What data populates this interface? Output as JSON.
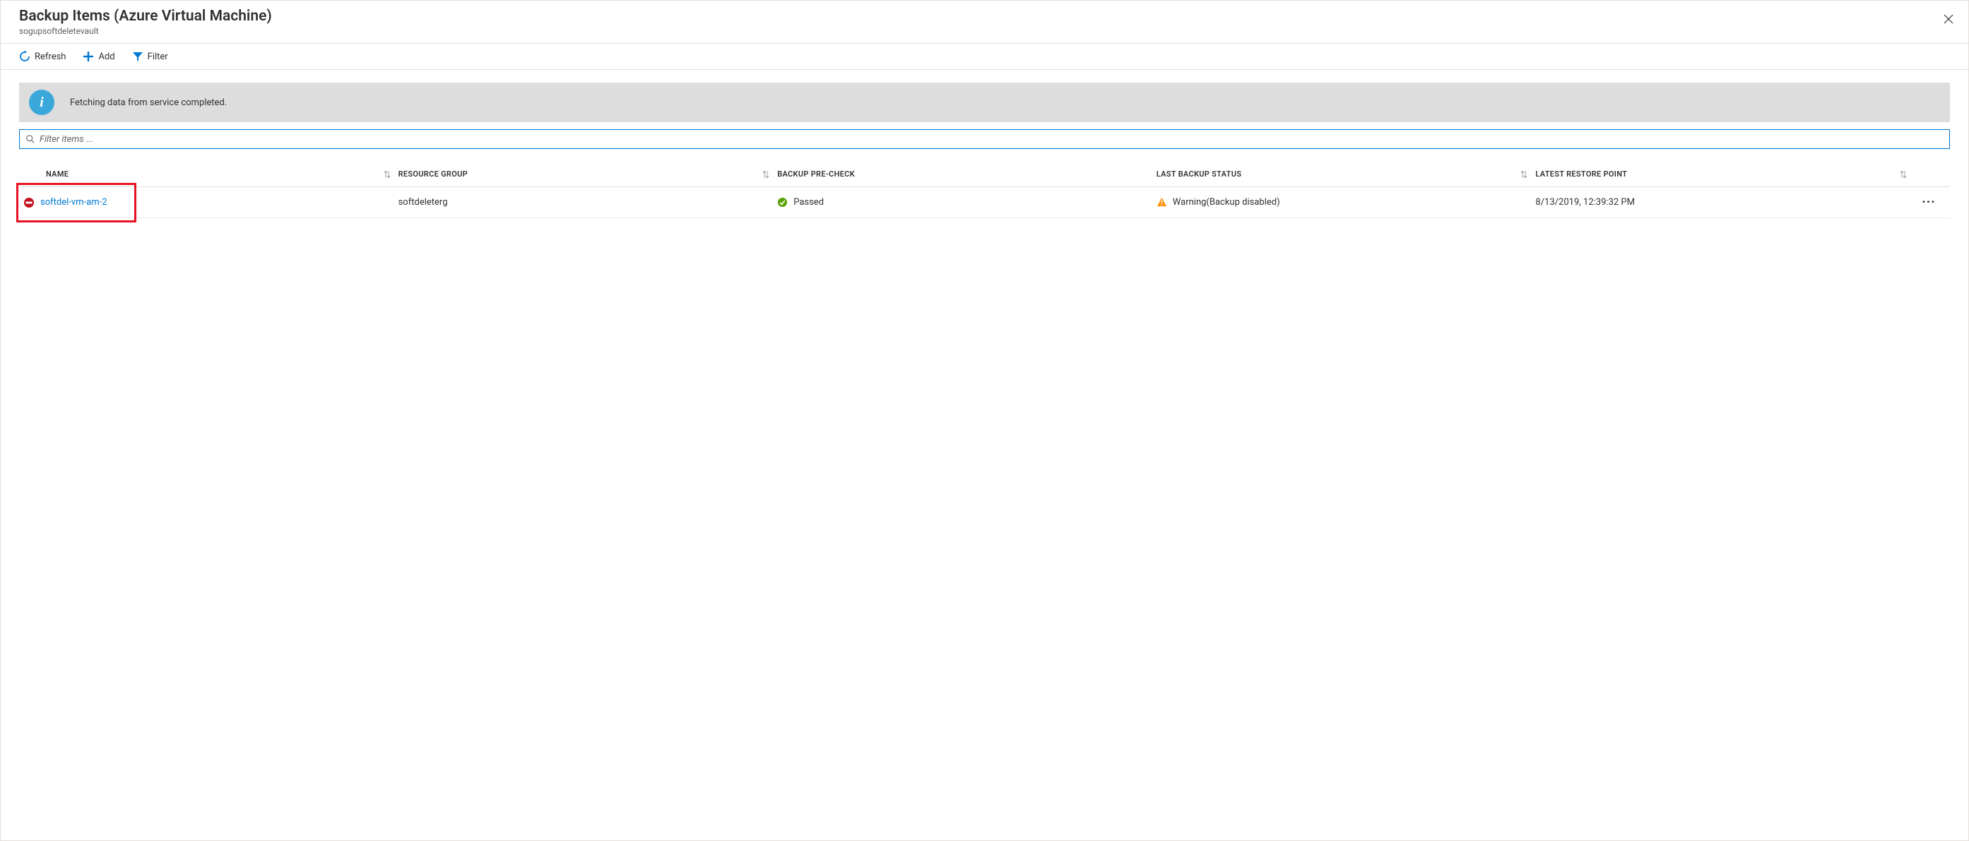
{
  "header": {
    "title": "Backup Items (Azure Virtual Machine)",
    "subtitle": "sogupsoftdeletevault"
  },
  "toolbar": {
    "refresh_label": "Refresh",
    "add_label": "Add",
    "filter_label": "Filter"
  },
  "banner": {
    "message": "Fetching data from service completed."
  },
  "search": {
    "placeholder": "Filter items ..."
  },
  "columns": {
    "name": "NAME",
    "resource_group": "RESOURCE GROUP",
    "backup_precheck": "BACKUP PRE-CHECK",
    "last_backup_status": "LAST BACKUP STATUS",
    "latest_restore_point": "LATEST RESTORE POINT"
  },
  "rows": [
    {
      "name": "softdel-vm-am-2",
      "resource_group": "softdeleterg",
      "precheck": "Passed",
      "last_status": "Warning(Backup disabled)",
      "restore_point": "8/13/2019, 12:39:32 PM"
    }
  ],
  "colors": {
    "accent": "#0078d4",
    "warning": "#ff8c00",
    "success": "#57a300",
    "error": "#c50f1f",
    "highlight": "#e81123"
  }
}
